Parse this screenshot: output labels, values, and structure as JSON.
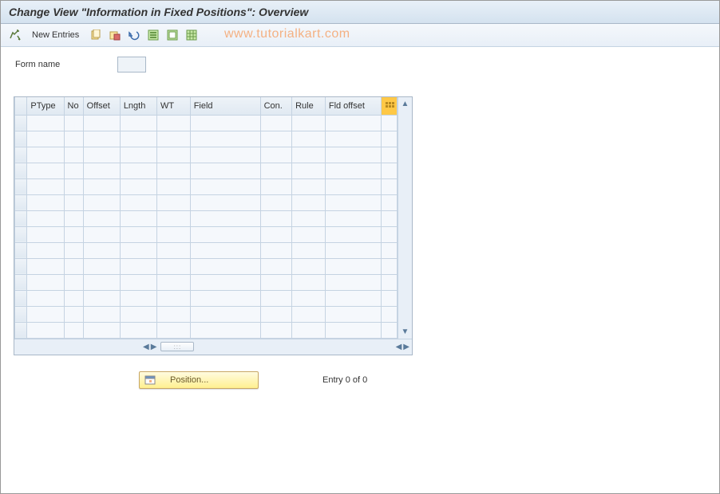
{
  "title": "Change View \"Information in Fixed Positions\": Overview",
  "toolbar": {
    "new_entries_label": "New Entries"
  },
  "watermark": "www.tutorialkart.com",
  "form": {
    "name_label": "Form name",
    "name_value": ""
  },
  "table": {
    "columns": {
      "ptype": "PType",
      "no": "No",
      "offset": "Offset",
      "length": "Lngth",
      "wt": "WT",
      "field": "Field",
      "con": "Con.",
      "rule": "Rule",
      "fld_offset": "Fld offset"
    },
    "rows": []
  },
  "footer": {
    "position_label": "Position...",
    "entry_status": "Entry 0 of 0"
  }
}
